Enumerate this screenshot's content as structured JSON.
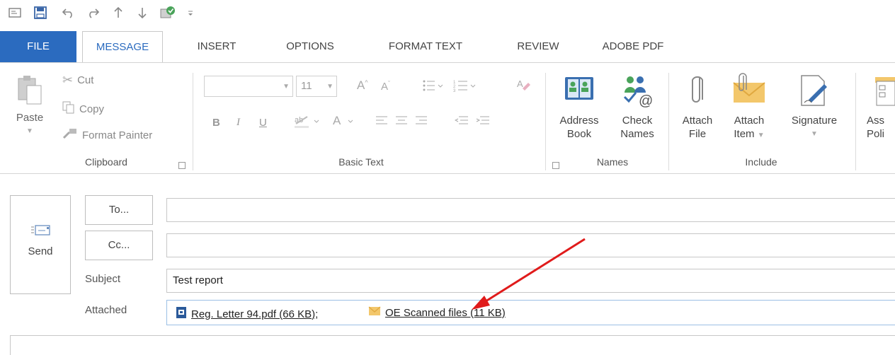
{
  "quick_access": {
    "icons": [
      "mail-icon",
      "save-icon",
      "undo-icon",
      "redo-icon",
      "up-arrow-icon",
      "down-arrow-icon",
      "grammar-check-icon",
      "customize-dropdown-icon"
    ]
  },
  "tabs": [
    {
      "label": "FILE"
    },
    {
      "label": "MESSAGE"
    },
    {
      "label": "INSERT"
    },
    {
      "label": "OPTIONS"
    },
    {
      "label": "FORMAT TEXT"
    },
    {
      "label": "REVIEW"
    },
    {
      "label": "ADOBE PDF"
    }
  ],
  "active_tab": "MESSAGE",
  "ribbon": {
    "clipboard": {
      "label": "Clipboard",
      "paste": "Paste",
      "cut": "Cut",
      "copy": "Copy",
      "format_painter": "Format Painter"
    },
    "basic_text": {
      "label": "Basic Text",
      "font_name": "",
      "font_size": "11",
      "bold": "B",
      "italic": "I",
      "underline": "U"
    },
    "names": {
      "label": "Names",
      "address_book_line1": "Address",
      "address_book_line2": "Book",
      "check_names_line1": "Check",
      "check_names_line2": "Names"
    },
    "include": {
      "label": "Include",
      "attach_file_line1": "Attach",
      "attach_file_line2": "File",
      "attach_item_line1": "Attach",
      "attach_item_line2": "Item",
      "signature": "Signature"
    },
    "policy": {
      "line1": "Ass",
      "line2": "Poli"
    }
  },
  "compose": {
    "send": "Send",
    "to_button": "To...",
    "cc_button": "Cc...",
    "to_value": "",
    "cc_value": "",
    "subject_label": "Subject",
    "subject_value": "Test report",
    "attached_label": "Attached",
    "attachments": [
      {
        "name": "Reg. Letter 94.pdf (66 KB);",
        "icon": "pdf-file-icon"
      },
      {
        "name": "OE Scanned files  (11 KB)",
        "icon": "email-item-icon"
      }
    ]
  },
  "colors": {
    "accent": "#2b6bbf",
    "annotation_arrow": "#e01b1b",
    "attachment_border": "#9bbfe5"
  }
}
